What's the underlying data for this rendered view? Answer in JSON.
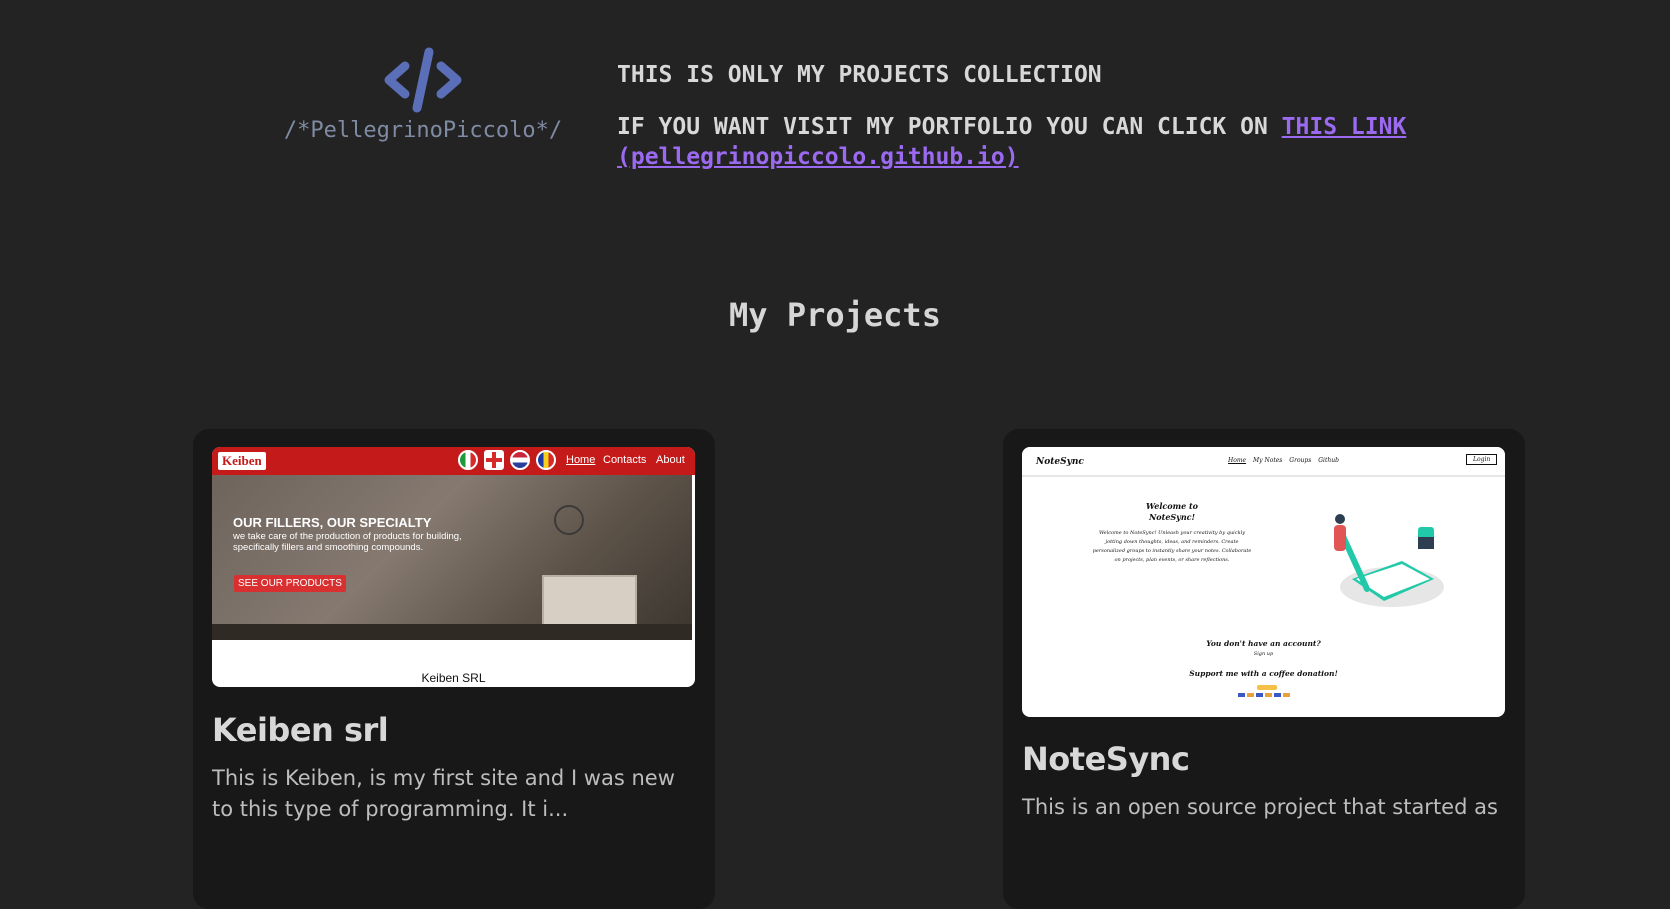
{
  "header": {
    "logo_icon": "code-icon",
    "logo_text": "/*PellegrinoPiccolo*/",
    "intro_line1": "THIS IS ONLY MY PROJECTS COLLECTION",
    "intro_line2_prefix": "IF YOU WANT VISIT MY PORTFOLIO YOU CAN CLICK ON ",
    "intro_link_text": "THIS LINK (pellegrinopiccolo.github.io)",
    "accent_color": "#9b6af0"
  },
  "section": {
    "title": "My Projects"
  },
  "projects": [
    {
      "title": "Keiben srl",
      "description": "This is Keiben, is my first site and I was new to this type of programming. It i...",
      "thumbnail": {
        "logo": "Keiben",
        "flags": [
          "Italiano",
          "English",
          "Nederlands",
          "Română"
        ],
        "nav": [
          "Home",
          "Contacts",
          "About"
        ],
        "headline": "OUR FILLERS, OUR SPECIALTY",
        "subtext": "we take care of the production of products for building, specifically fillers and smoothing compounds.",
        "button": "SEE OUR PRODUCTS",
        "footer": "Keiben SRL"
      }
    },
    {
      "title": "NoteSync",
      "description": "This is an open source project that started as",
      "thumbnail": {
        "brand": "NoteSync",
        "nav": [
          "Home",
          "My Notes",
          "Groups",
          "Github"
        ],
        "login": "Login",
        "welcome_title": "Welcome to NoteSync!",
        "welcome_text": "Welcome to NoteSync! Unleash your creativity by quickly jotting down thoughts, ideas, and reminders. Create personalized groups to instantly share your notes. Collaborate on projects, plan events, or share reflections.",
        "no_account": "You don't have an account?",
        "signup": "Sign up",
        "support": "Support me with a coffee donation!"
      }
    }
  ]
}
